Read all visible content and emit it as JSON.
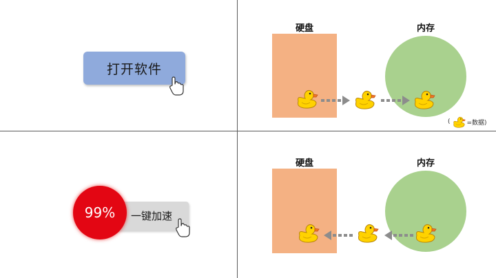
{
  "top_left": {
    "button_label": "打开软件"
  },
  "bottom_left": {
    "percent": "99%",
    "button_label": "一键加速"
  },
  "top_right": {
    "disk_label": "硬盘",
    "memory_label": "内存"
  },
  "bottom_right": {
    "disk_label": "硬盘",
    "memory_label": "内存"
  },
  "legend": {
    "open_paren": "(",
    "text": "=数据)"
  },
  "icons": [
    "cursor-hand-icon",
    "duck-icon",
    "arrow-right-icon",
    "arrow-left-icon"
  ],
  "colors": {
    "button_blue": "#8faadc",
    "disk_orange": "#f4b183",
    "memory_green": "#a9d18e",
    "percent_red": "#e30613",
    "pill_gray": "#d9d9d9"
  }
}
